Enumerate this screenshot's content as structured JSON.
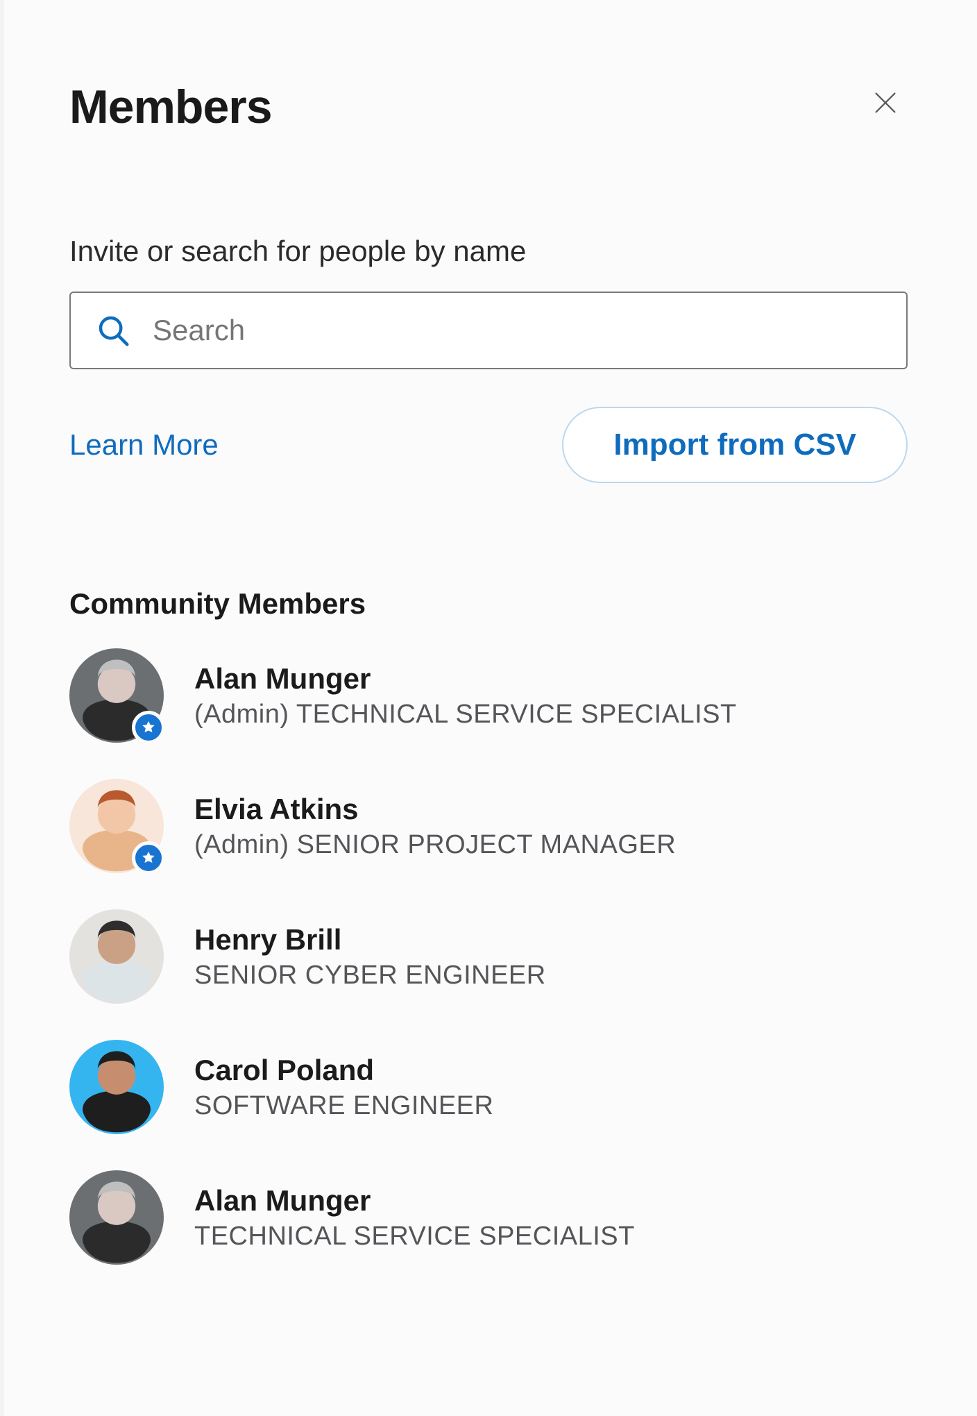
{
  "header": {
    "title": "Members"
  },
  "search": {
    "label": "Invite or search for people by name",
    "placeholder": "Search"
  },
  "actions": {
    "learn_more_label": "Learn More",
    "import_csv_label": "Import from CSV"
  },
  "members_section": {
    "heading": "Community Members"
  },
  "members": [
    {
      "name": "Alan Munger",
      "role": "(Admin) TECHNICAL SERVICE SPECIALIST",
      "is_admin": true,
      "avatar_bg": "#6b6f72",
      "avatar_kind": "person-gray"
    },
    {
      "name": "Elvia Atkins",
      "role": "(Admin) SENIOR PROJECT MANAGER",
      "is_admin": true,
      "avatar_bg": "#f7e6d9",
      "avatar_kind": "person-orange"
    },
    {
      "name": "Henry Brill",
      "role": "SENIOR CYBER ENGINEER",
      "is_admin": false,
      "avatar_bg": "#e4e2df",
      "avatar_kind": "person-neutral"
    },
    {
      "name": "Carol Poland",
      "role": "SOFTWARE ENGINEER",
      "is_admin": false,
      "avatar_bg": "#35b5ef",
      "avatar_kind": "person-blue"
    },
    {
      "name": "Alan Munger",
      "role": "TECHNICAL SERVICE SPECIALIST",
      "is_admin": false,
      "avatar_bg": "#6b6f72",
      "avatar_kind": "person-gray"
    }
  ]
}
